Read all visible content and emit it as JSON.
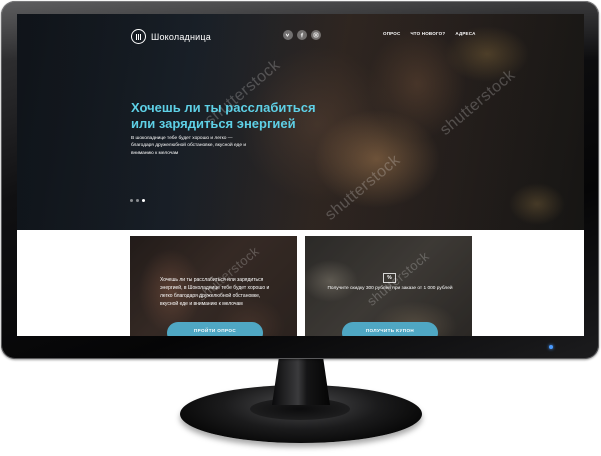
{
  "site": {
    "logo_text": "Шоколадница",
    "nav": [
      {
        "label": "ОПРОС"
      },
      {
        "label": "ЧТО НОВОГО?"
      },
      {
        "label": "АДРЕСА"
      }
    ],
    "social": [
      "vk-icon",
      "facebook-icon",
      "instagram-icon"
    ]
  },
  "hero": {
    "title": "Хочешь ли ты расслабиться или зарядиться энергией",
    "body": "В шоколаднице тебе будет хорошо и легко — благодаря дружелюбной обстановке, вкусной еде и вниманию к мелочам",
    "slides": 3,
    "active_slide": 1
  },
  "cards": [
    {
      "text": "Хочешь ли ты расслабиться или зарядиться энергией, в Шоколаднице тебе будет хорошо и легко благодаря дружелюбной обстановке, вкусной еде и вниманию к мелочам",
      "button": "ПРОЙТИ ОПРОС"
    },
    {
      "badge": "%",
      "text": "Получите скидку 300 рублей при заказе от 1 000 рублей",
      "button": "ПОЛУЧИТЬ КУПОН"
    }
  ],
  "watermark": "shutterstock",
  "colors": {
    "accent": "#5ed0e6",
    "button": "#4fa7c3",
    "power_led": "#4a9bff"
  }
}
